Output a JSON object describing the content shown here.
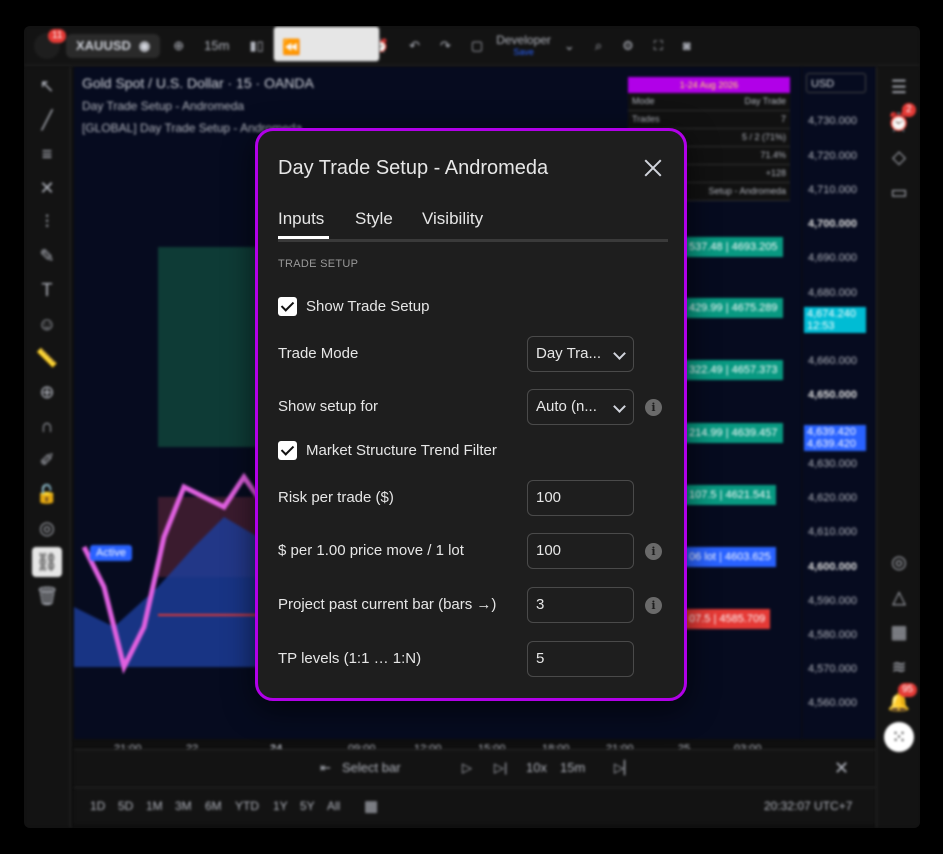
{
  "topbar": {
    "notification_count": "11",
    "symbol": "XAUUSD",
    "interval": "15m",
    "layout_name": "Developer",
    "layout_status": "Save"
  },
  "chart": {
    "title": "Gold Spot / U.S. Dollar · 15 · OANDA",
    "indicator_1": "Day Trade Setup - Andromeda",
    "indicator_2": "[GLOBAL] Day Trade Setup - Andromeda",
    "active_label": "Active",
    "currency": "USD",
    "info_panel": {
      "header": "1-24 Aug 2026",
      "rows": [
        {
          "k": "Mode",
          "v": "Day Trade"
        },
        {
          "k": "Trades",
          "v": "7"
        },
        {
          "k": "",
          "v": "5 / 2 (71%)"
        },
        {
          "k": "",
          "v": "71.4%"
        },
        {
          "k": "",
          "v": "+128"
        },
        {
          "k": "",
          "v": "Setup - Andromeda"
        }
      ]
    },
    "price_labels": [
      "4,730.000",
      "4,720.000",
      "4,710.000",
      "4,700.000",
      "4,690.000",
      "4,680.000",
      "4,670.000",
      "4,660.000",
      "4,650.000",
      "4,640.000",
      "4,630.000",
      "4,620.000",
      "4,610.000",
      "4,600.000",
      "4,590.000",
      "4,580.000",
      "4,570.000",
      "4,560.000"
    ],
    "current_price": "4,674.240",
    "countdown": "12:53",
    "price_tag_1": "4,639.420",
    "price_tag_2": "4,639.420",
    "targets": [
      "537.48 | 4693.205",
      "429.99 | 4675.289",
      "322.49 | 4657.373",
      "214.99 | 4639.457",
      "107.5 | 4621.541",
      "06 lot | 4603.625",
      "07.5 | 4585.709"
    ],
    "time_labels": [
      "21:00",
      "22",
      "24",
      "09:00",
      "12:00",
      "15:00",
      "18:00",
      "21:00",
      "25",
      "03:00"
    ]
  },
  "replay": {
    "select_bar": "Select bar",
    "speed": "10x",
    "interval": "15m"
  },
  "bottombar": {
    "ranges": [
      "1D",
      "5D",
      "1M",
      "3M",
      "6M",
      "YTD",
      "1Y",
      "5Y",
      "All"
    ],
    "clock": "20:32:07 UTC+7"
  },
  "rightbar": {
    "alerts_badge": "2",
    "notifications_badge": "95"
  },
  "dialog": {
    "title": "Day Trade Setup - Andromeda",
    "tabs": [
      "Inputs",
      "Style",
      "Visibility"
    ],
    "section": "TRADE SETUP",
    "show_trade_setup": "Show Trade Setup",
    "trade_mode_label": "Trade Mode",
    "trade_mode_value": "Day Tra...",
    "show_setup_for_label": "Show setup for",
    "show_setup_for_value": "Auto (n...",
    "market_filter": "Market Structure Trend Filter",
    "risk_label": "Risk per trade ($)",
    "risk_value": "100",
    "price_move_label": "$ per 1.00 price move / 1 lot",
    "price_move_value": "100",
    "project_label": "Project past current bar (bars →)",
    "project_value": "3",
    "tp_label": "TP levels (1:1 … 1:N)",
    "tp_value": "5",
    "info_glyph": "i"
  }
}
